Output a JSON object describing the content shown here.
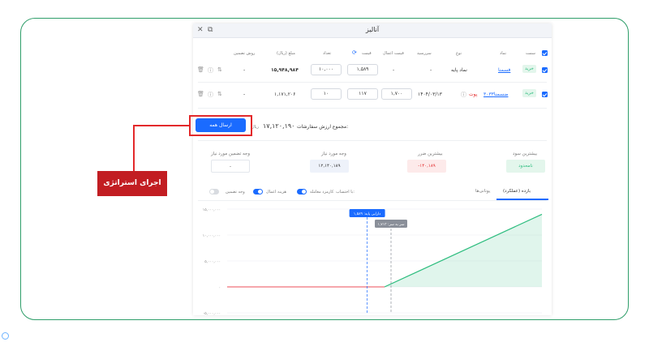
{
  "window": {
    "title": "آنالیز"
  },
  "table": {
    "headers": {
      "side": "سمت",
      "symbol": "نماد",
      "type": "نوع",
      "expiry": "سررسید",
      "strike": "قیمت اعمال",
      "price": "قیمت",
      "qty": "تعداد",
      "amount": "مبلغ (ریال)",
      "margin": "روش تضمین"
    },
    "rows": [
      {
        "side": "خرید",
        "symbol": "فسمنا",
        "type": "نماد پایه",
        "expiry": "-",
        "strike": "-",
        "price": "۱,۵۸۹",
        "qty": "۱۰,۰۰۰",
        "amount": "۱۵,۹۴۸,۹۸۴",
        "margin": "-"
      },
      {
        "side": "خرید",
        "symbol": "ضسمنا۳۰۳۳",
        "type": "پوت",
        "expiry": "۱۴۰۴/۰۳/۱۳",
        "strike": "۱,۷۰۰",
        "price": "۱۱۷",
        "qty": "۱۰",
        "amount": "۱,۱۷۱,۲۰۶",
        "margin": "-"
      }
    ]
  },
  "summary": {
    "send_label": "ارسال همه",
    "total_label": "مجموع ارزش سفارشات:",
    "total_value": "۱۷,۱۲۰,۱۹۰",
    "total_unit": "ریال"
  },
  "stats": {
    "max_profit_label": "بیشترین سود",
    "max_profit_value": "نامحدود",
    "max_loss_label": "بیشترین ضرر",
    "max_loss_value": "-۱۴۰,۱۸۹",
    "required_cash_label": "وجه مورد نیاز",
    "required_cash_value": "۱۲,۱۴۰,۱۸۹",
    "required_margin_label": "وجه تضمین مورد نیاز",
    "required_margin_value": "-"
  },
  "chart_tabs": {
    "tab1": "بازده (عملکرد)",
    "tab2": "یونانی‌ها",
    "calc_label": "با احتساب:",
    "opt1": "کارمزد معامله",
    "opt2": "هزینه اعمال",
    "opt3": "وجه تضمین"
  },
  "callout": {
    "label": "اجرای استراتژی"
  },
  "colors": {
    "accent": "#1a6bff",
    "frame": "#2f9e6a",
    "highlight": "#e3292b",
    "callout_bg": "#c21d22",
    "profit": "#2ebd7f",
    "loss": "#f0707a"
  },
  "chart_data": {
    "type": "line",
    "y_ticks": [
      "۱۵,۰۰۰,۰۰۰",
      "۱۰,۰۰۰,۰۰۰",
      "۵,۰۰۰,۰۰۰",
      "۰",
      "-۵,۰۰۰,۰۰۰"
    ],
    "ylim": [
      -5000000,
      15000000
    ],
    "xlim": [
      0,
      1
    ],
    "series": [
      {
        "values_x": [
          0,
          0.5,
          1.0
        ],
        "values_y": [
          0,
          0,
          14000000
        ]
      }
    ],
    "annotations": [
      {
        "label": "دارایی پایه: ۱,۵۸۹",
        "x": 0.45
      },
      {
        "label": "سر به سر: ۱,۷۱۳",
        "x": 0.5
      }
    ],
    "grid": true
  }
}
